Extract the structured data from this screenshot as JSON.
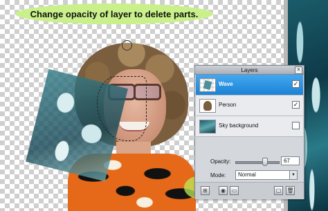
{
  "callout": {
    "text": "Change opacity of layer to delete parts."
  },
  "layers_panel": {
    "title": "Layers",
    "close_glyph": "×",
    "layers": [
      {
        "name": "Wave",
        "selected": true,
        "visible_check": "✓",
        "thumb_icon": "wave-thumbnail"
      },
      {
        "name": "Person",
        "selected": false,
        "visible_check": "✓",
        "thumb_icon": "person-thumbnail"
      },
      {
        "name": "Sky background",
        "selected": false,
        "visible_check": "",
        "thumb_icon": "sky-thumbnail"
      }
    ],
    "opacity": {
      "label": "Opacity:",
      "value": "67",
      "slider_fraction": 0.67
    },
    "mode": {
      "label": "Mode:",
      "value": "Normal",
      "arrow_glyph": "▼"
    },
    "toolbar": {
      "buttons": [
        {
          "icon": "layer-style-icon",
          "glyph": "⊞"
        },
        {
          "icon": "mask-icon",
          "glyph": "◉"
        },
        {
          "icon": "folder-icon",
          "glyph": "▭"
        },
        {
          "icon": "new-layer-icon",
          "glyph": "▢"
        },
        {
          "icon": "trash-icon",
          "glyph": "🗑"
        }
      ]
    }
  },
  "colors": {
    "callout_highlight": "#c9f08a",
    "selected_layer": "#1c82d4"
  }
}
